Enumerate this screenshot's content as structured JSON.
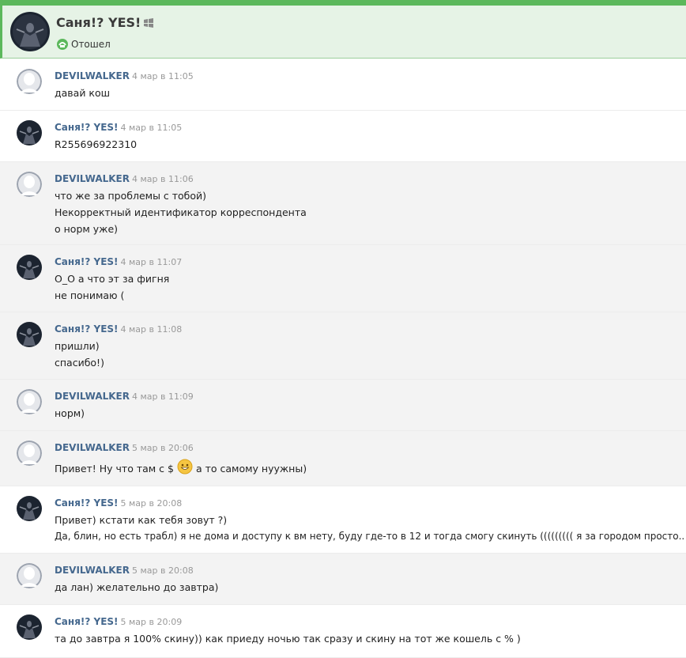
{
  "header": {
    "name": "Саня!? YES!",
    "status": "Отошел",
    "platform_icon": "windows-icon",
    "status_icon": "away-icon"
  },
  "colors": {
    "accent_green": "#5cb85c",
    "header_bg": "#e6f3e6",
    "author_link": "#45688e",
    "time_grey": "#999999",
    "row_alt": "#f3f3f3"
  },
  "messages": [
    {
      "author": "DEVILWALKER",
      "time": "4 мар в 11:05",
      "lines": [
        "давай кош"
      ]
    },
    {
      "author": "Саня!? YES!",
      "time": "4 мар в 11:05",
      "lines": [
        "R255696922310"
      ]
    },
    {
      "author": "DEVILWALKER",
      "time": "4 мар в 11:06",
      "lines": [
        "что же за проблемы с тобой)",
        "Некорректный идентификатор корреспондента",
        "о норм уже)"
      ]
    },
    {
      "author": "Саня!? YES!",
      "time": "4 мар в 11:07",
      "lines": [
        "О_О а что эт за фигня",
        "не понимаю ("
      ]
    },
    {
      "author": "Саня!? YES!",
      "time": "4 мар в 11:08",
      "lines": [
        "пришли)",
        "спасибо!)"
      ]
    },
    {
      "author": "DEVILWALKER",
      "time": "4 мар в 11:09",
      "lines": [
        "норм)"
      ]
    },
    {
      "author": "DEVILWALKER",
      "time": "5 мар в 20:06",
      "lines": [
        "Привет! Ну что там с $",
        "а то самому нуужны)"
      ]
    },
    {
      "author": "Саня!? YES!",
      "time": "5 мар в 20:08",
      "lines": [
        "Привет) кстати как тебя зовут ?)",
        "Да, блин, но есть трабл) я не дома и доступу к вм нету, буду где-то в 12 и тогда смогу скинуть ((((((((( я за городом просто.."
      ]
    },
    {
      "author": "DEVILWALKER",
      "time": "5 мар в 20:08",
      "lines": [
        "да лан) желательно до завтра)"
      ]
    },
    {
      "author": "Саня!? YES!",
      "time": "5 мар в 20:09",
      "lines": [
        "та до завтра я 100% скину)) как приеду ночью так сразу и скину на тот же кошель с % )"
      ]
    }
  ]
}
